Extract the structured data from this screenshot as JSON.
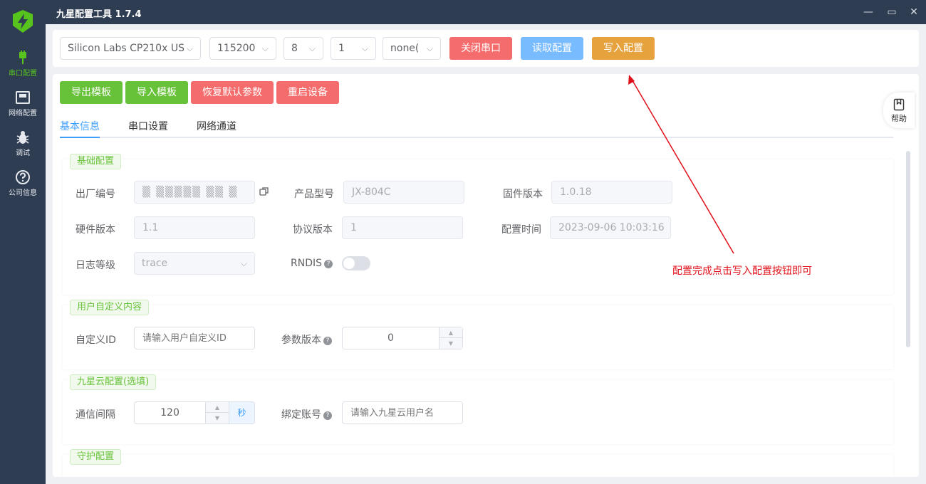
{
  "app": {
    "title": "九星配置工具 1.7.4"
  },
  "window_controls": {
    "minimize": "—",
    "maximize": "▭",
    "close": "✕"
  },
  "sidebar": {
    "items": [
      {
        "label": "串口配置",
        "icon": "usb-plug-icon",
        "active": true
      },
      {
        "label": "网络配置",
        "icon": "ethernet-port-icon"
      },
      {
        "label": "调试",
        "icon": "bug-icon"
      },
      {
        "label": "公司信息",
        "icon": "question-circle-icon"
      }
    ]
  },
  "toolbar": {
    "port": "Silicon Labs CP210x US",
    "baud": "115200",
    "databits": "8",
    "stopbits": "1",
    "parity": "none(",
    "close_port": "关闭串口",
    "read_config": "读取配置",
    "write_config": "写入配置"
  },
  "actions": {
    "export_template": "导出模板",
    "import_template": "导入模板",
    "restore_defaults": "恢复默认参数",
    "restart_device": "重启设备"
  },
  "tabs": [
    "基本信息",
    "串口设置",
    "网络通道"
  ],
  "help_label": "帮助",
  "basic": {
    "tag": "基础配置",
    "serial_label": "出厂编号",
    "serial_value": "▒ ▒▒▒▒▒ ▒▒ ▒",
    "model_label": "产品型号",
    "model_value": "JX-804C",
    "firmware_label": "固件版本",
    "firmware_value": "1.0.18",
    "hardware_label": "硬件版本",
    "hardware_value": "1.1",
    "protocol_label": "协议版本",
    "protocol_value": "1",
    "config_time_label": "配置时间",
    "config_time_value": "2023-09-06 10:03:16",
    "log_level_label": "日志等级",
    "log_level_value": "trace",
    "rndis_label": "RNDIS"
  },
  "custom": {
    "tag": "用户自定义内容",
    "custom_id_label": "自定义ID",
    "custom_id_placeholder": "请输入用户自定义ID",
    "param_version_label": "参数版本",
    "param_version_value": "0"
  },
  "cloud": {
    "tag": "九星云配置(选填)",
    "interval_label": "通信间隔",
    "interval_value": "120",
    "interval_unit": "秒",
    "account_label": "绑定账号",
    "account_placeholder": "请输入九星云用户名"
  },
  "guard": {
    "tag": "守护配置"
  },
  "annotation": {
    "text": "配置完成点击写入配置按钮即可",
    "color": "#e0101a"
  },
  "colors": {
    "accent": "#409eff",
    "success": "#67c23a",
    "danger": "#f56c6c",
    "warning": "#e6a23c",
    "sidebar": "#2f3d52"
  }
}
